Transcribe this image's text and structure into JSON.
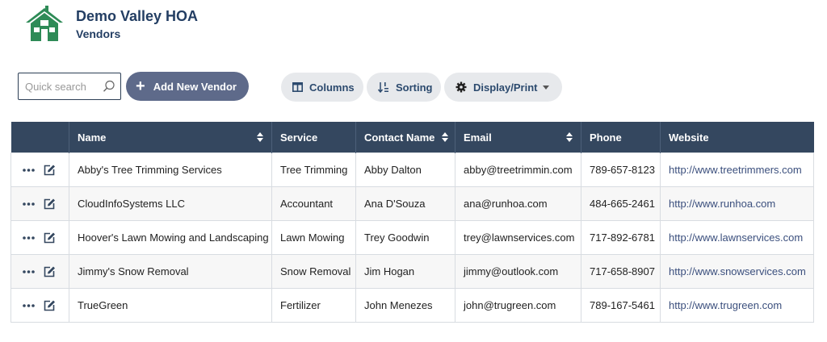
{
  "header": {
    "org_name": "Demo Valley HOA",
    "page_title": "Vendors",
    "logo_icon": "house-icon",
    "logo_color": "#2e8b57"
  },
  "toolbar": {
    "search_placeholder": "Quick search",
    "add_label": "Add New Vendor",
    "columns_label": "Columns",
    "sorting_label": "Sorting",
    "display_label": "Display/Print"
  },
  "colors": {
    "title": "#233e63",
    "table_header": "#34475f",
    "primary_button": "#5e6a8a",
    "link": "#3b4f7d"
  },
  "table": {
    "headers": [
      "",
      "Name",
      "Service",
      "Contact Name",
      "Email",
      "Phone",
      "Website"
    ],
    "rows": [
      [
        "Abby's Tree Trimming Services",
        "Tree Trimming",
        "Abby Dalton",
        "abby@treetrimmin.com",
        "789-657-8123",
        "http://www.treetrimmers.com"
      ],
      [
        "CloudInfoSystems LLC",
        "Accountant",
        "Ana D'Souza",
        "ana@runhoa.com",
        "484-665-2461",
        "http://www.runhoa.com"
      ],
      [
        "Hoover's Lawn Mowing and Landscaping",
        "Lawn Mowing",
        "Trey Goodwin",
        "trey@lawnservices.com",
        "717-892-6781",
        "http://www.lawnservices.com"
      ],
      [
        "Jimmy's Snow Removal",
        "Snow Removal",
        "Jim Hogan",
        "jimmy@outlook.com",
        "717-658-8907",
        "http://www.snowservices.com"
      ],
      [
        "TrueGreen",
        "Fertilizer",
        "John Menezes",
        "john@trugreen.com",
        "789-167-5461",
        "http://www.trugreen.com"
      ]
    ]
  }
}
